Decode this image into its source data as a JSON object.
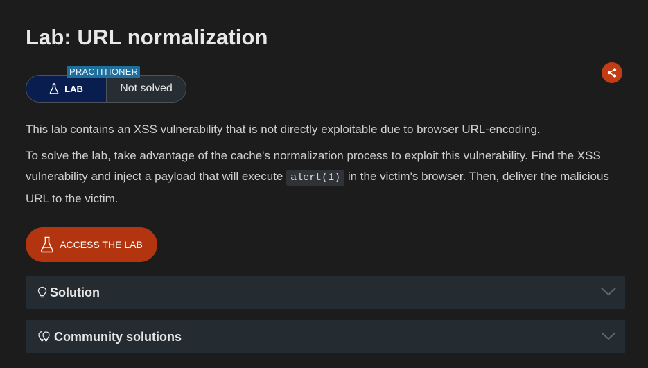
{
  "page": {
    "title": "Lab: URL normalization"
  },
  "badge": {
    "level": "PRACTITIONER",
    "type_label": "LAB",
    "status": "Not solved"
  },
  "description": {
    "intro": "This lab contains an XSS vulnerability that is not directly exploitable due to browser URL-encoding.",
    "task_part1": "To solve the lab, take advantage of the cache's normalization process to exploit this vulnerability. Find the XSS vulnerability and inject a payload that will execute ",
    "task_code": "alert(1)",
    "task_part2": " in the victim's browser. Then, deliver the malicious URL to the victim."
  },
  "actions": {
    "access_label": "ACCESS THE LAB"
  },
  "sections": [
    {
      "label": "Solution",
      "icon": "lightbulb-icon"
    },
    {
      "label": "Community solutions",
      "icon": "lightbulbs-icon"
    }
  ],
  "colors": {
    "background": "#1c1c1c",
    "accent": "#b3350f",
    "badge_navy": "#0a1d4f",
    "level_blue": "#1f6f9c",
    "accordion_bg": "#242c31"
  }
}
